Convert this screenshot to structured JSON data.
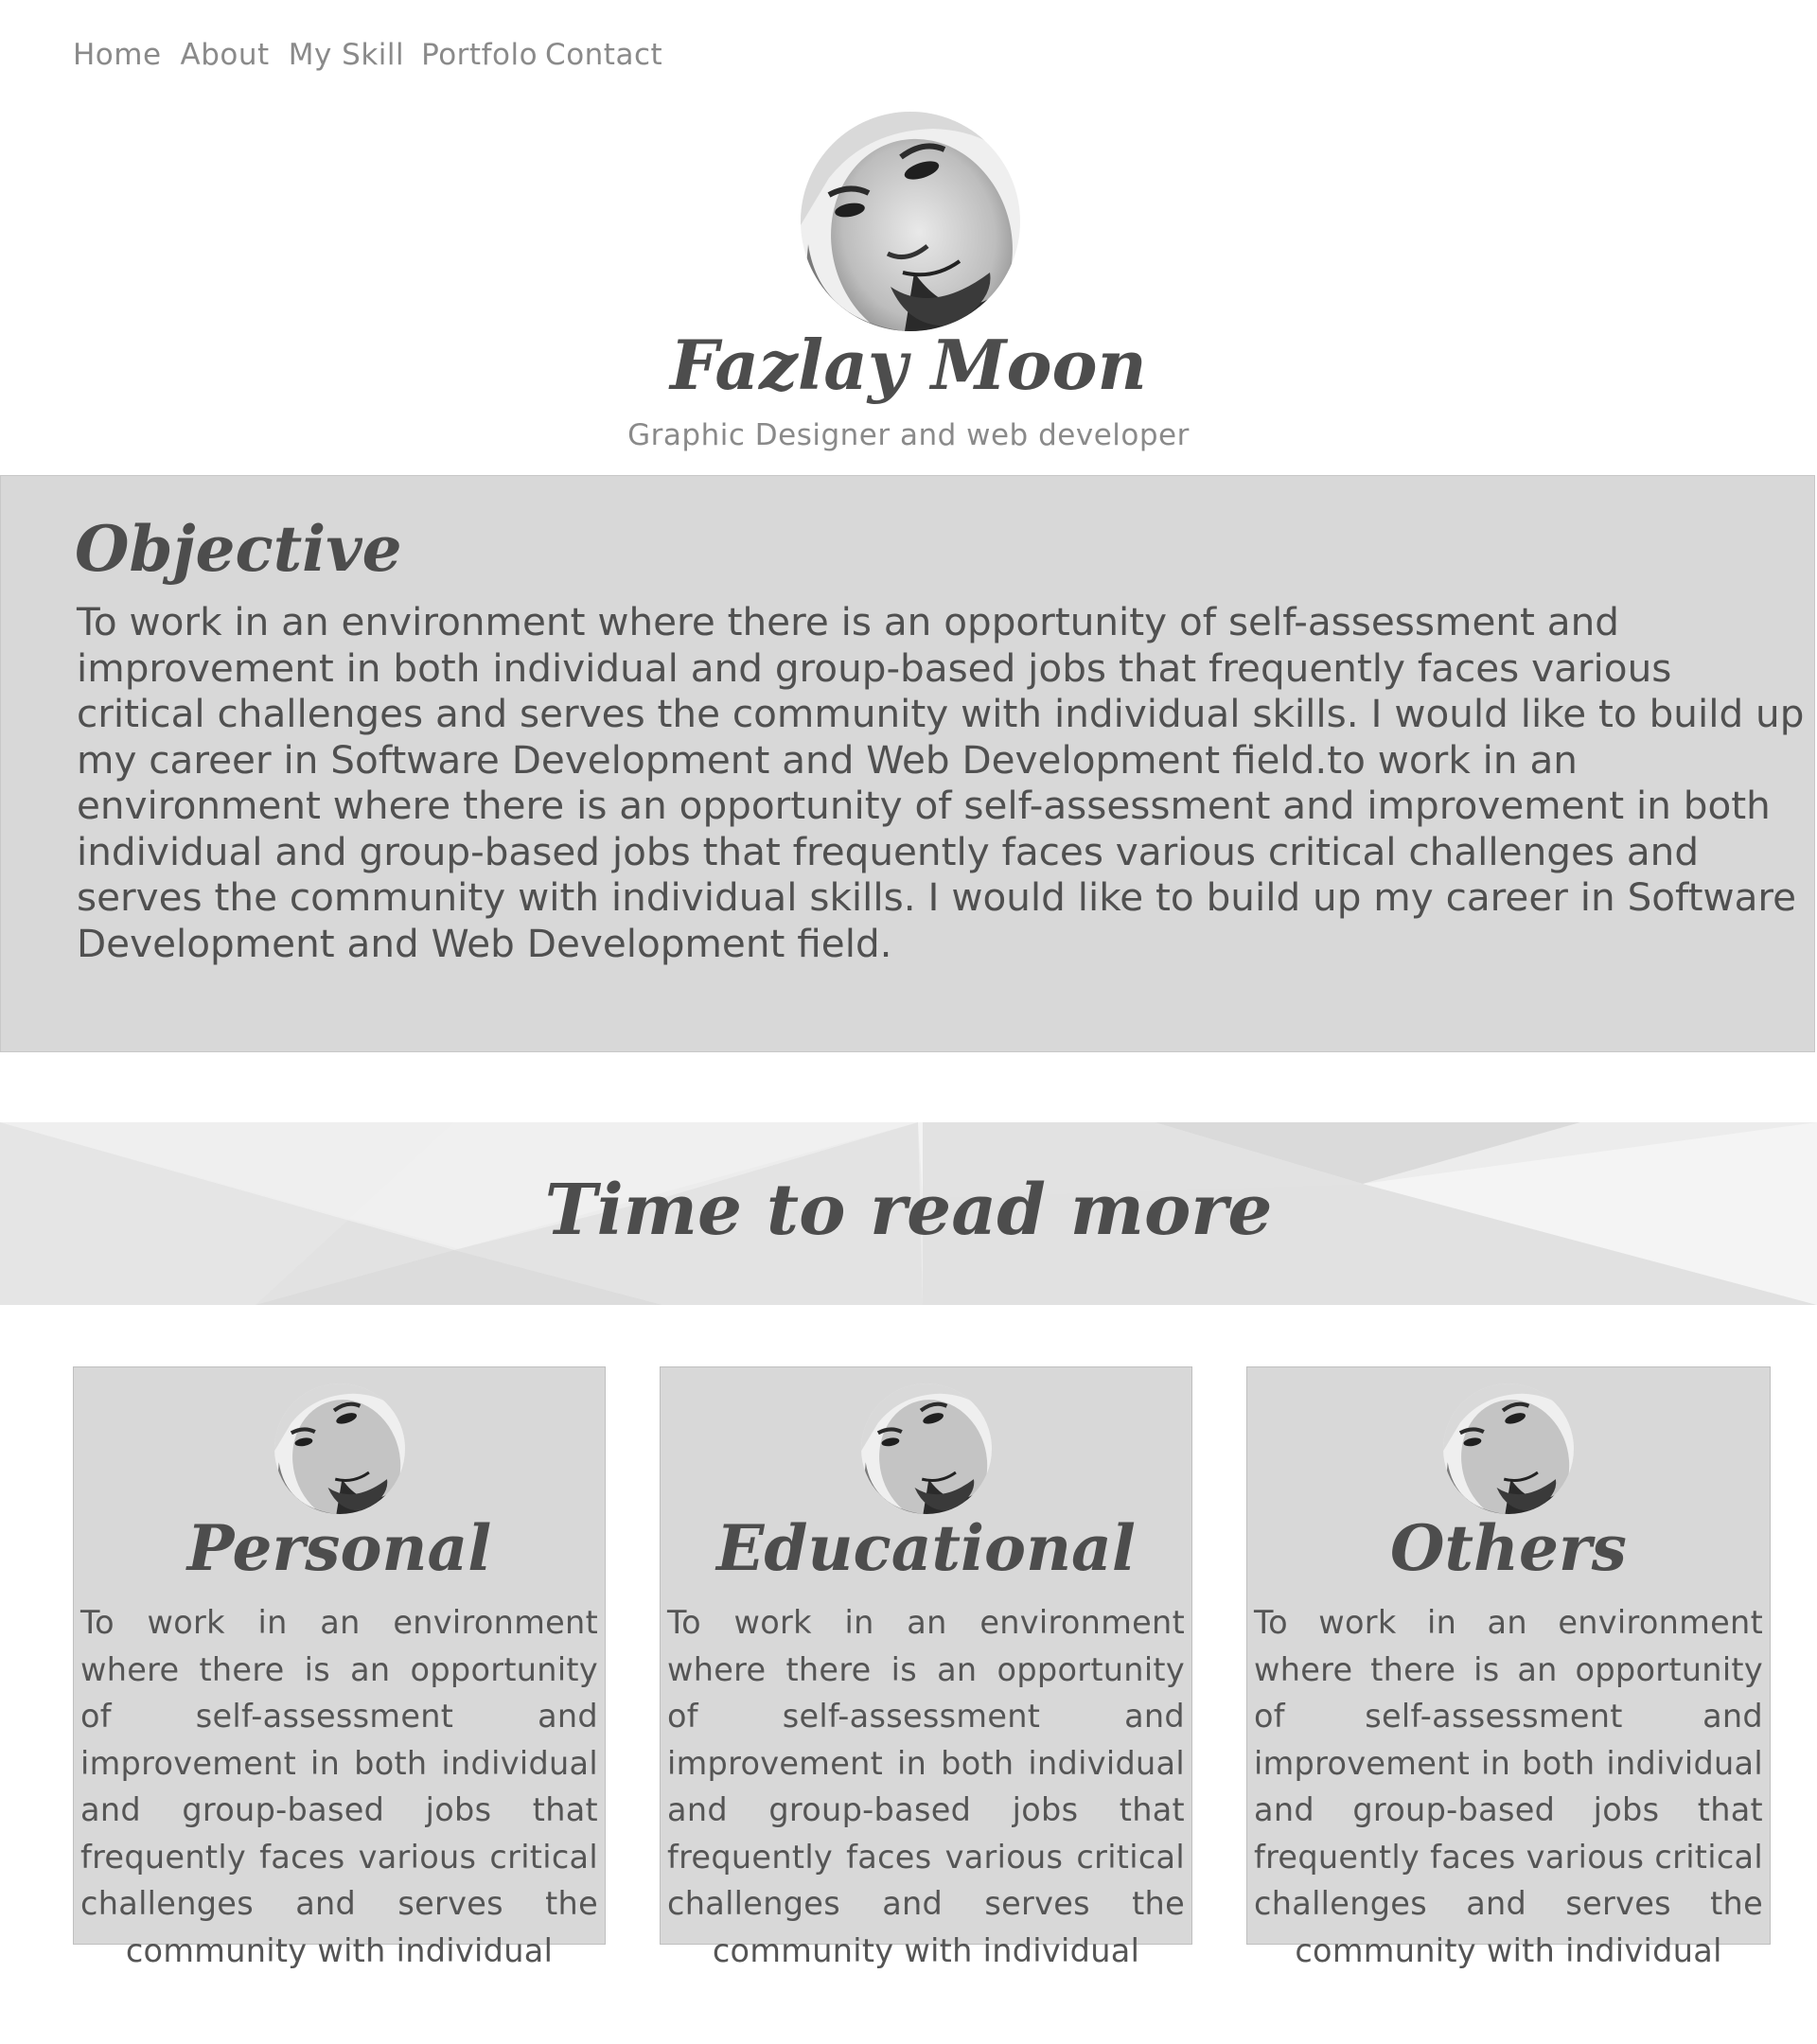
{
  "nav": {
    "items": [
      {
        "label": "Home"
      },
      {
        "label": "About"
      },
      {
        "label": "My Skill"
      },
      {
        "label": "Portfolo"
      },
      {
        "label": "Contact"
      }
    ]
  },
  "hero": {
    "name": "Fazlay Moon",
    "tagline": "Graphic Designer and web developer"
  },
  "objective": {
    "title": "Objective",
    "text": "To work in an environment where there is an opportunity of self-assessment and improvement in both individual and group-based jobs that frequently faces various critical challenges and serves the community with individual skills. I would like to build up my career in Software Development and Web Development field.to work in an environment where there is an opportunity of self-assessment and improvement in both individual and group-based jobs that frequently faces various critical challenges and serves the community with individual skills. I would like to build up my career in Software Development and Web Development field."
  },
  "banner": {
    "title": "Time to read more"
  },
  "cards": [
    {
      "title": "Personal",
      "text": "To work in an environment where there is an opportunity of self-assessment and improvement in both individual and group-based jobs that frequently faces various critical challenges and serves the community with individual"
    },
    {
      "title": "Educational",
      "text": "To work in an environment where there is an opportunity of self-assessment and improvement in both individual and group-based jobs that frequently faces various critical challenges and serves the community with individual"
    },
    {
      "title": "Others",
      "text": "To work in an environment where there is an opportunity of self-assessment and improvement in both individual and group-based jobs that frequently faces various critical challenges and serves the community with individual"
    }
  ],
  "colors": {
    "text_dark": "#4d4d4d",
    "text_muted": "#8a8a8a",
    "panel_bg": "#d8d8d8",
    "page_bg": "#ffffff"
  },
  "icons": [
    "portrait-photo"
  ]
}
